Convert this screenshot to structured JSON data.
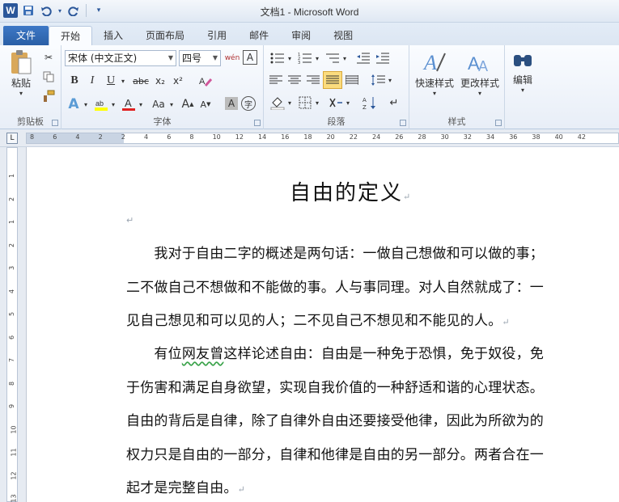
{
  "window": {
    "title": "文档1 - Microsoft Word",
    "app_letter": "W"
  },
  "tabs": [
    {
      "label": "文件"
    },
    {
      "label": "开始"
    },
    {
      "label": "插入"
    },
    {
      "label": "页面布局"
    },
    {
      "label": "引用"
    },
    {
      "label": "邮件"
    },
    {
      "label": "审阅"
    },
    {
      "label": "视图"
    }
  ],
  "ribbon": {
    "clipboard": {
      "label": "剪贴板",
      "paste_label": "粘贴"
    },
    "font": {
      "label": "字体",
      "font_name": "宋体 (中文正文)",
      "font_size": "四号",
      "bold": "B",
      "italic": "I",
      "underline": "U",
      "strike": "abc",
      "subscript": "x₂",
      "superscript": "x²",
      "change_case": "Aa",
      "grow": "A",
      "shrink": "A",
      "clear": "A",
      "phonetic": "wén",
      "charborder": "A",
      "enclose": "字"
    },
    "paragraph": {
      "label": "段落"
    },
    "styles": {
      "label": "样式",
      "quick_styles": "快速样式",
      "change_styles": "更改样式"
    },
    "editing": {
      "label": "编辑"
    }
  },
  "ruler": {
    "h_numbers": [
      "8",
      "6",
      "4",
      "2",
      "2",
      "4",
      "6",
      "8",
      "10",
      "12",
      "14",
      "16",
      "18",
      "20",
      "22",
      "24",
      "26",
      "28",
      "30",
      "32",
      "34",
      "36",
      "38",
      "40",
      "42"
    ],
    "v_numbers": [
      "1",
      "2",
      "1",
      "2",
      "3",
      "4",
      "5",
      "6",
      "7",
      "8",
      "9",
      "10",
      "11",
      "12",
      "13"
    ],
    "tab_marker": "L"
  },
  "document": {
    "title": "自由的定义",
    "paragraphs": [
      {
        "lines": [
          "　　我对于自由二字的概述是两句话：一做自己想做和可以做的事；",
          "二不做自己不想做和不能做的事。人与事同理。对人自然就成了：一",
          "见自己想见和可以见的人；二不见自己不想见和不能见的人。"
        ]
      },
      {
        "lines_a": "　　有位",
        "squiggle": "网友曾",
        "lines_b": "这样论述自由：自由是一种免于恐惧，免于奴役，免",
        "lines": [
          "于伤害和满足自身欲望，实现自我价值的一种舒适和谐的心理状态。",
          "自由的背后是自律，除了自律外自由还要接受他律，因此为所欲为的",
          "权力只是自由的一部分，自律和他律是自由的另一部分。两者合在一",
          "起才是完整自由。"
        ]
      }
    ],
    "para_mark": "↵"
  },
  "colors": {
    "file_tab": "#2a5fa6",
    "ribbon_bg": "#fafcff",
    "accent_blue": "#2b579a",
    "squiggle_green": "#3aa34a"
  }
}
